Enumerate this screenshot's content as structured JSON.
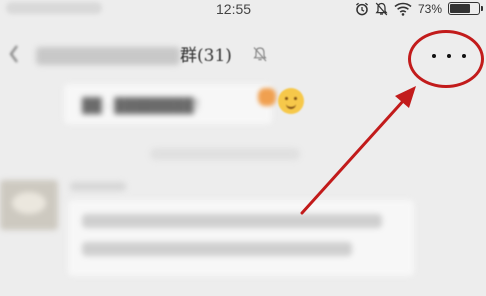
{
  "status_bar": {
    "time": "12:55",
    "battery_percent": "73%",
    "battery_level": 0.73
  },
  "header": {
    "title": "群(31)"
  },
  "colors": {
    "annotation_red": "#c21b1b",
    "background": "#ededed",
    "bubble": "#f7f7f7"
  },
  "icons": [
    "back-chevron-icon",
    "alarm-clock-icon",
    "mute-bell-icon",
    "wifi-icon",
    "battery-icon",
    "mute-bell-icon",
    "more-dots-icon",
    "smile-emoji-icon"
  ]
}
